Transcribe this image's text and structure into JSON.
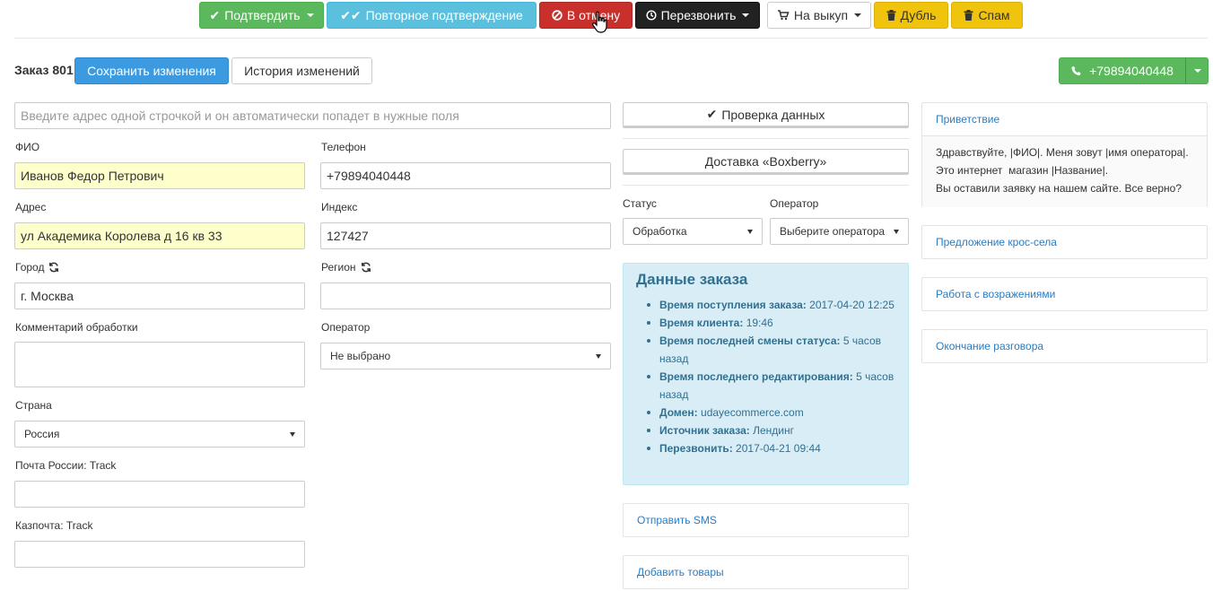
{
  "toolbar": {
    "confirm": "Подтвердить",
    "reconfirm": "Повторное подтверждение",
    "cancel": "В отмену",
    "callback": "Перезвонить",
    "buyout": "На выкуп",
    "duplicate": "Дубль",
    "spam": "Спам"
  },
  "order": {
    "title": "Заказ 801",
    "save": "Сохранить изменения",
    "history": "История изменений",
    "phone_button": "+79894040448"
  },
  "form": {
    "address_line_placeholder": "Введите адрес одной строчкой и он автоматически попадет в нужные поля",
    "fio_label": "ФИО",
    "fio_value": "Иванов Федор Петрович",
    "phone_label": "Телефон",
    "phone_value": "+79894040448",
    "address_label": "Адрес",
    "address_value": "ул Академика Королева д 16 кв 33",
    "index_label": "Индекс",
    "index_value": "127427",
    "city_label": "Город",
    "city_value": "г. Москва",
    "region_label": "Регион",
    "region_value": "",
    "comment_label": "Комментарий обработки",
    "operator_label": "Оператор",
    "operator_value": "Не выбрано",
    "country_label": "Страна",
    "country_value": "Россия",
    "russian_post_label": "Почта России: Track",
    "kazpost_label": "Казпочта: Track"
  },
  "middle": {
    "check_data": "Проверка данных",
    "delivery": "Доставка «Boxberry»",
    "status_label": "Статус",
    "status_value": "Обработка",
    "operator_label": "Оператор",
    "operator_value": "Выберите оператора",
    "info_title": "Данные заказа",
    "info": [
      {
        "label": "Время поступления заказа:",
        "value": "2017-04-20 12:25"
      },
      {
        "label": "Время клиента:",
        "value": "19:46"
      },
      {
        "label": "Время последней смены статуса:",
        "value": "5 часов назад"
      },
      {
        "label": "Время последнего редактирования:",
        "value": "5 часов назад"
      },
      {
        "label": "Домен:",
        "value": "udayecommerce.com"
      },
      {
        "label": "Источник заказа:",
        "value": "Лендинг"
      },
      {
        "label": "Перезвонить:",
        "value": "2017-04-21 09:44"
      }
    ],
    "send_sms": "Отправить SMS",
    "add_goods": "Добавить товары"
  },
  "script": {
    "greeting_title": "Приветствие",
    "greeting_line1": "Здравствуйте, |ФИО|. Меня зовут |имя оператора|.",
    "greeting_line2": "Это интернет  магазин |Название|.",
    "greeting_line3": "Вы оставили заявку на нашем сайте. Все верно?",
    "cross_sell": "Предложение крос-села",
    "objections": "Работа с возражениями",
    "end_call": "Окончание разговора"
  },
  "colors": {
    "green": "#5cb85c",
    "cyan": "#5bc0de",
    "red": "#c9302c",
    "dark": "#222222",
    "yellow": "#f0c40c",
    "blue": "#3c9be0",
    "info_bg": "#d9edf7",
    "field_highlight": "#ffffcc"
  },
  "icons": {
    "confirm": "check-icon",
    "reconfirm": "double-check-icon",
    "cancel": "ban-icon",
    "callback": "clock-icon",
    "buyout": "cart-icon",
    "duplicate": "trash-icon",
    "spam": "trash-icon",
    "phone": "phone-icon",
    "refresh": "refresh-icon",
    "cursor": "hand-cursor-icon"
  }
}
